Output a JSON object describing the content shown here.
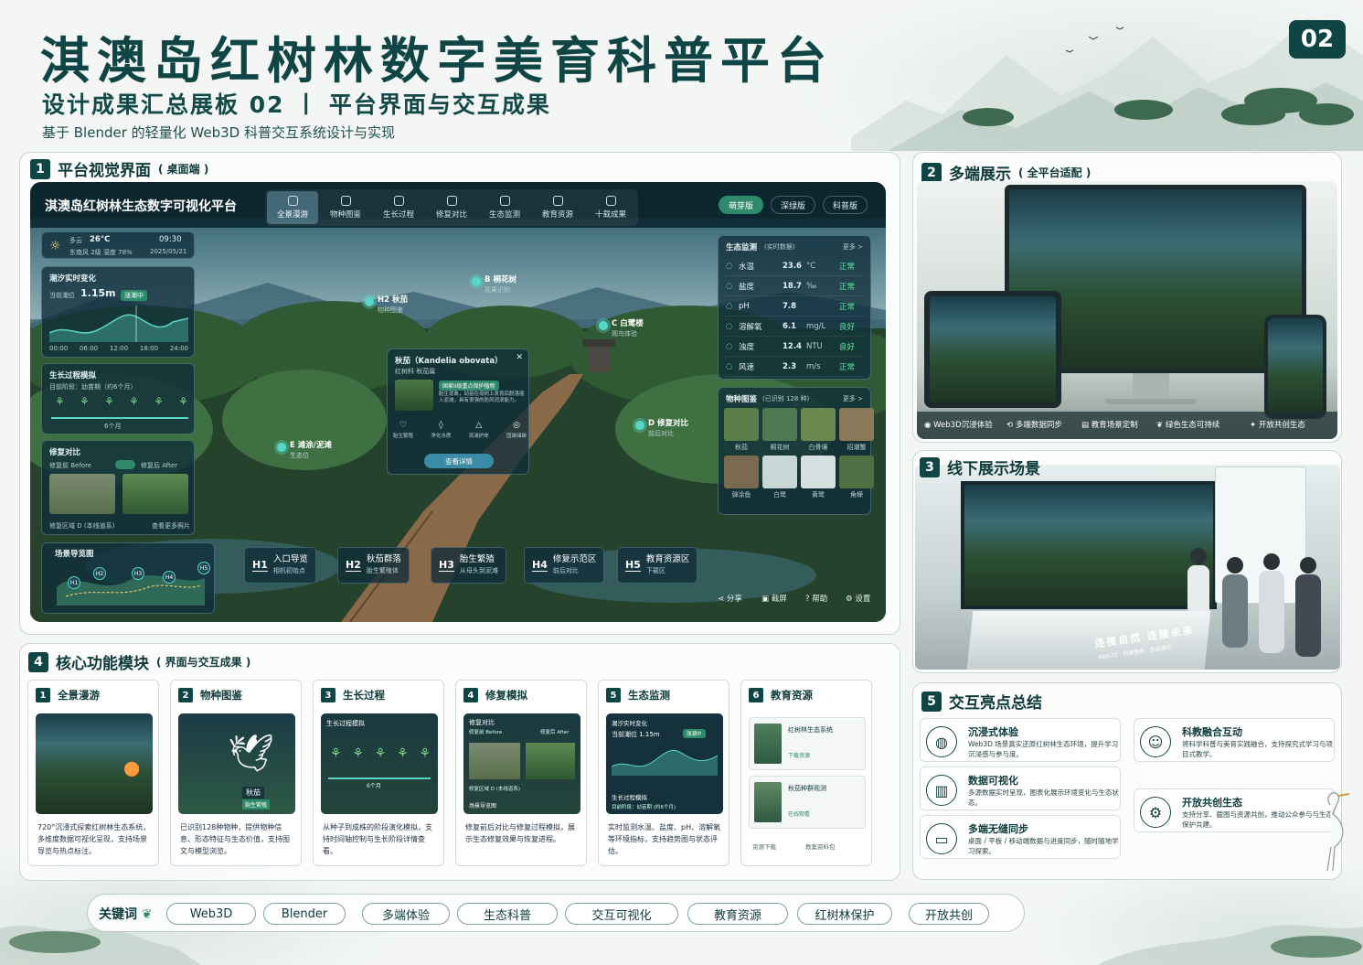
{
  "header": {
    "title": "淇澳岛红树林数字美育科普平台",
    "subtitle": "设计成果汇总展板 02 丨 平台界面与交互成果",
    "tagline": "基于 Blender 的轻量化 Web3D 科普交互系统设计与实现",
    "board_no": "02"
  },
  "sec1": {
    "num": "1",
    "title": "平台视觉界面",
    "note": "( 桌面端 )"
  },
  "app": {
    "title": "淇澳岛红树林生态数字可视化平台",
    "nav": [
      "全景漫游",
      "物种图鉴",
      "生长过程",
      "修复对比",
      "生态监测",
      "教育资源",
      "十载成果"
    ],
    "modes": [
      "萌芽版",
      "深绿版",
      "科普版"
    ],
    "weather": {
      "place": "多云",
      "temp": "26°C",
      "detail": "东南风 2级 湿度 78%",
      "time": "09:30",
      "date": "2025/05/21"
    },
    "tide": {
      "title": "潮汐实时变化",
      "label": "当前潮位",
      "value": "1.15m",
      "status": "涨潮中",
      "ticks": [
        "00:00",
        "06:00",
        "12:00",
        "18:00",
        "24:00"
      ]
    },
    "growth": {
      "title": "生长过程模拟",
      "stage": "目前阶段：幼苗期（约6个月）",
      "month": "6个月"
    },
    "restore": {
      "title": "修复对比",
      "before": "修复前 Before",
      "after": "修复后 After",
      "area": "修复区域 D (本线道系)",
      "more": "查看更多照片"
    },
    "map": {
      "title": "场景导览图",
      "points": [
        "H1",
        "H2",
        "H3",
        "H4",
        "H5"
      ]
    },
    "hotspots": [
      {
        "code": "B 桐花树",
        "sub": "花果识别"
      },
      {
        "code": "H2 秋茄",
        "sub": "物种图鉴"
      },
      {
        "code": "C 白鹭楼",
        "sub": "观鸟体验"
      },
      {
        "code": "E 滩涂/泥滩",
        "sub": "生态位"
      },
      {
        "code": "D 修复对比",
        "sub": "前后对比"
      }
    ],
    "species_card": {
      "name": "秋茄（Kandelia obovata）",
      "family": "红树科 秋茄属",
      "tag": "国家II级重点保护植物",
      "desc": "胎生现象，幼苗在母树上发育后脱落插入泥滩，具有很强的防风消浪能力。",
      "icons": [
        "胎生繁殖",
        "净化水质",
        "流淌护岸",
        "固碳储碳"
      ],
      "button": "查看详情"
    },
    "monitor": {
      "title": "生态监测",
      "note": "(实时数据)",
      "more": "更多 >",
      "rows": [
        {
          "name": "水温",
          "value": "23.6",
          "unit": "°C",
          "state": "正常"
        },
        {
          "name": "盐度",
          "value": "18.7",
          "unit": "‰",
          "state": "正常"
        },
        {
          "name": "pH",
          "value": "7.8",
          "unit": "",
          "state": "正常"
        },
        {
          "name": "溶解氧",
          "value": "6.1",
          "unit": "mg/L",
          "state": "良好"
        },
        {
          "name": "浊度",
          "value": "12.4",
          "unit": "NTU",
          "state": "良好"
        },
        {
          "name": "风速",
          "value": "2.3",
          "unit": "m/s",
          "state": "正常"
        }
      ]
    },
    "species": {
      "title": "物种图鉴",
      "note": "(已识别 128 种)",
      "more": "更多 >",
      "items": [
        "秋茄",
        "桐花树",
        "白骨壤",
        "招潮蟹",
        "弹涂鱼",
        "白鹭",
        "黄鹭",
        "角蝾"
      ]
    },
    "hnav": [
      {
        "code": "H1",
        "name": "入口导览",
        "sub": "相机初始点"
      },
      {
        "code": "H2",
        "name": "秋茄群落",
        "sub": "胎生繁殖体"
      },
      {
        "code": "H3",
        "name": "胎生繁殖",
        "sub": "从母头到泥滩"
      },
      {
        "code": "H4",
        "name": "修复示范区",
        "sub": "前后对比"
      },
      {
        "code": "H5",
        "name": "教育资源区",
        "sub": "下载区"
      }
    ],
    "actions": [
      "分享",
      "截屏",
      "帮助",
      "设置"
    ]
  },
  "sec2": {
    "num": "2",
    "title": "多端展示",
    "note": "( 全平台适配 )",
    "features": [
      "Web3D沉浸体验",
      "多端数据同步",
      "教育场景定制",
      "绿色生态可持续",
      "开放共创生态"
    ]
  },
  "sec3": {
    "num": "3",
    "title": "线下展示场景",
    "banner": "连接自然 连接未来",
    "banner_sub": "Web3D · 科普教育 · 生态保护"
  },
  "sec4": {
    "num": "4",
    "title": "核心功能模块",
    "note": "( 界面与交互成果 )",
    "modules": [
      {
        "num": "1",
        "title": "全景漫游",
        "desc": "720°沉浸式探索红树林生态系统，多维度数据可视化呈现，支持场景导览与热点标注。"
      },
      {
        "num": "2",
        "title": "物种图鉴",
        "desc": "已识别128种物种，提供物种信息、形态特征与生态价值，支持图文与模型浏览。"
      },
      {
        "num": "3",
        "title": "生长过程",
        "desc": "从种子到成株的阶段演化模拟，支持时间轴控制与生长阶段详情查看。"
      },
      {
        "num": "4",
        "title": "修复模拟",
        "desc": "修复前后对比与修复过程模拟，展示生态修复效果与恢复进程。"
      },
      {
        "num": "5",
        "title": "生态监测",
        "desc": "实时监测水温、盐度、pH、溶解氧等环境指标，支持趋势图与状态评估。"
      },
      {
        "num": "6",
        "title": "教育资源",
        "desc": ""
      }
    ],
    "m2": {
      "species": "秋茄",
      "tag": "胎生繁殖"
    },
    "m5": {
      "tide": "潮汐实时变化",
      "level": "当前潮位 1.15m",
      "status": "涨潮中",
      "growth": "生长过程模拟",
      "stage": "目前阶段：幼苗期 (约6个月)"
    },
    "m6": {
      "item1": "红树林生态系统",
      "item2": "秋茄种群观测",
      "btn1": "下载资源",
      "btn2": "在线观看",
      "btm1": "资源下载",
      "btm2": "教案资料包"
    }
  },
  "sec5": {
    "num": "5",
    "title": "交互亮点总结",
    "items": [
      {
        "title": "沉浸式体验",
        "desc": "Web3D 场景真实还原红树林生态环境，提升学习沉浸感与参与度。"
      },
      {
        "title": "科教融合互动",
        "desc": "将科学科普与美育实践融合，支持探究式学习与项目式教学。"
      },
      {
        "title": "数据可视化",
        "desc": "多源数据实时呈现，图表化展示环境变化与生态状态。"
      },
      {
        "title": "开放共创生态",
        "desc": "支持分享、截图与资源共创，推动公众参与与生态保护共建。"
      },
      {
        "title": "多端无缝同步",
        "desc": "桌面 / 平板 / 移动端数据与进度同步，随时随地学习探索。"
      }
    ]
  },
  "keywords": {
    "label": "关键词",
    "items": [
      "Web3D",
      "Blender",
      "多端体验",
      "生态科普",
      "交互可视化",
      "教育资源",
      "红树林保护",
      "开放共创"
    ]
  },
  "colors": {
    "primary": "#0f4544",
    "accent": "#2e8a6a",
    "glass": "#102d3a"
  }
}
